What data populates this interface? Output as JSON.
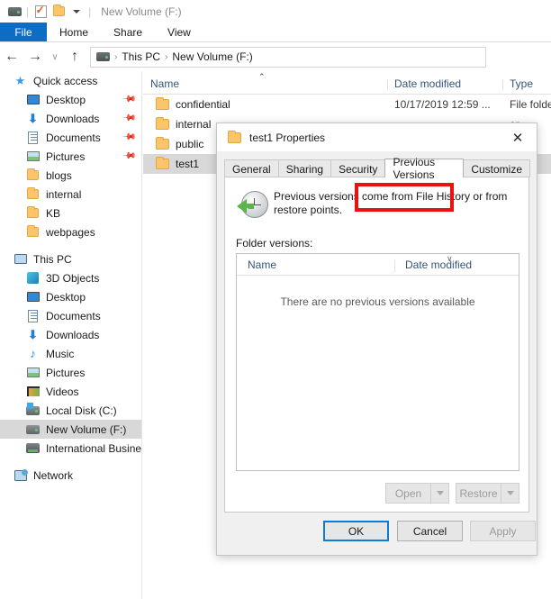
{
  "window": {
    "title": "New Volume (F:)",
    "qat": [
      {
        "name": "drive-icon",
        "label": ""
      },
      {
        "name": "properties-icon",
        "label": ""
      },
      {
        "name": "new-folder-icon",
        "label": ""
      },
      {
        "name": "customize-qat-icon",
        "label": ""
      }
    ]
  },
  "ribbon": {
    "tabs": [
      {
        "label": "File",
        "active": true
      },
      {
        "label": "Home",
        "active": false
      },
      {
        "label": "Share",
        "active": false
      },
      {
        "label": "View",
        "active": false
      }
    ]
  },
  "address": {
    "back": "←",
    "forward": "→",
    "recent": "∨",
    "up": "↑",
    "crumbs": [
      "This PC",
      "New Volume (F:)"
    ],
    "separator": "›"
  },
  "sidebar": {
    "groups": [
      {
        "header": {
          "label": "Quick access",
          "icon": "star-icon"
        },
        "items": [
          {
            "label": "Desktop",
            "icon": "desktop-icon",
            "pinned": true
          },
          {
            "label": "Downloads",
            "icon": "downloads-icon",
            "pinned": true
          },
          {
            "label": "Documents",
            "icon": "documents-icon",
            "pinned": true
          },
          {
            "label": "Pictures",
            "icon": "pictures-icon",
            "pinned": true
          },
          {
            "label": "blogs",
            "icon": "folder-icon",
            "pinned": false
          },
          {
            "label": "internal",
            "icon": "folder-icon",
            "pinned": false
          },
          {
            "label": "KB",
            "icon": "folder-icon",
            "pinned": false
          },
          {
            "label": "webpages",
            "icon": "folder-icon",
            "pinned": false
          }
        ]
      },
      {
        "header": {
          "label": "This PC",
          "icon": "this-pc-icon"
        },
        "items": [
          {
            "label": "3D Objects",
            "icon": "3d-objects-icon",
            "pinned": false
          },
          {
            "label": "Desktop",
            "icon": "desktop-icon",
            "pinned": false
          },
          {
            "label": "Documents",
            "icon": "documents-icon",
            "pinned": false
          },
          {
            "label": "Downloads",
            "icon": "downloads-icon",
            "pinned": false
          },
          {
            "label": "Music",
            "icon": "music-icon",
            "pinned": false
          },
          {
            "label": "Pictures",
            "icon": "pictures-icon",
            "pinned": false
          },
          {
            "label": "Videos",
            "icon": "videos-icon",
            "pinned": false
          },
          {
            "label": "Local Disk (C:)",
            "icon": "local-disk-icon",
            "pinned": false
          },
          {
            "label": "New Volume (F:)",
            "icon": "drive-icon",
            "pinned": false,
            "selected": true
          },
          {
            "label": "International Busine",
            "icon": "network-drive-icon",
            "pinned": false
          }
        ]
      },
      {
        "header": {
          "label": "Network",
          "icon": "network-icon"
        },
        "items": []
      }
    ]
  },
  "filelist": {
    "columns": [
      {
        "label": "Name",
        "sorted": "asc"
      },
      {
        "label": "Date modified",
        "sorted": ""
      },
      {
        "label": "Type",
        "sorted": ""
      }
    ],
    "rows": [
      {
        "name": "confidential",
        "date": "10/17/2019 12:59 ...",
        "type": "File folder",
        "selected": false
      },
      {
        "name": "internal",
        "date": "",
        "type": "er",
        "selected": false
      },
      {
        "name": "public",
        "date": "",
        "type": "er",
        "selected": false
      },
      {
        "name": "test1",
        "date": "",
        "type": "er",
        "selected": true
      }
    ],
    "sort_caret": "⌃"
  },
  "dialog": {
    "title": "test1 Properties",
    "close_label": "✕",
    "tabs": [
      {
        "label": "General",
        "active": false
      },
      {
        "label": "Sharing",
        "active": false
      },
      {
        "label": "Security",
        "active": false
      },
      {
        "label": "Previous Versions",
        "active": true,
        "highlighted": true
      },
      {
        "label": "Customize",
        "active": false
      }
    ],
    "info_text": "Previous versions come from File History or from restore points.",
    "folder_versions_label": "Folder versions:",
    "listview": {
      "columns": [
        {
          "label": "Name"
        },
        {
          "label": "Date modified"
        }
      ],
      "empty_message": "There are no previous versions available",
      "sort_caret": "∨",
      "rows": []
    },
    "action_buttons": [
      {
        "label": "Open",
        "enabled": false,
        "has_dropdown": true
      },
      {
        "label": "Restore",
        "enabled": false,
        "has_dropdown": true
      }
    ],
    "footer_buttons": [
      {
        "label": "OK",
        "enabled": true,
        "primary": true
      },
      {
        "label": "Cancel",
        "enabled": true,
        "primary": false
      },
      {
        "label": "Apply",
        "enabled": false,
        "primary": false
      }
    ]
  },
  "annotation": {
    "highlight_color": "#e81212",
    "target": "Previous Versions"
  }
}
